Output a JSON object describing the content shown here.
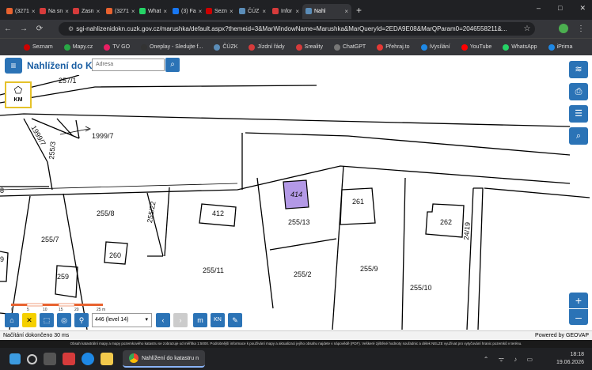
{
  "browser": {
    "tabs": [
      {
        "label": "(3271",
        "color": "#e8622f"
      },
      {
        "label": "Na sn",
        "color": "#d63b3b"
      },
      {
        "label": "Zasn",
        "color": "#d63b3b"
      },
      {
        "label": "(3271",
        "color": "#e8622f"
      },
      {
        "label": "What",
        "color": "#25d366"
      },
      {
        "label": "(3) Fa",
        "color": "#1877f2"
      },
      {
        "label": "Sezn",
        "color": "#cc0000"
      },
      {
        "label": "ČÚZ",
        "color": "#5b8db8"
      },
      {
        "label": "Infor",
        "color": "#d63b3b"
      },
      {
        "label": "Nahl",
        "color": "#5b8db8"
      }
    ],
    "new_tab": "+",
    "window_controls": [
      "–",
      "□",
      "✕"
    ],
    "url": "sgi-nahlizenidokn.cuzk.gov.cz/marushka/default.aspx?themeid=3&MarWindowName=Marushka&MarQueryId=2EDA9E08&MarQParam0=2046558211&...",
    "bookmarks": [
      {
        "label": "Seznam",
        "color": "#cc0000"
      },
      {
        "label": "Mapy.cz",
        "color": "#28a745"
      },
      {
        "label": "TV GO",
        "color": "#e91e63"
      },
      {
        "label": "Oneplay - Sledujte f...",
        "color": "#333"
      },
      {
        "label": "ČÚZK",
        "color": "#5b8db8"
      },
      {
        "label": "Jízdní řády",
        "color": "#d63b3b"
      },
      {
        "label": "Sreality",
        "color": "#d63b3b"
      },
      {
        "label": "ChatGPT",
        "color": "#777"
      },
      {
        "label": "Přehraj.to",
        "color": "#e53935"
      },
      {
        "label": "iVysílání",
        "color": "#1e88e5"
      },
      {
        "label": "YouTube",
        "color": "#ff0000"
      },
      {
        "label": "WhatsApp",
        "color": "#25d366"
      },
      {
        "label": "iPrima",
        "color": "#1e88e5"
      }
    ]
  },
  "app": {
    "title": "Nahlížení do KN",
    "search_placeholder": "Adresa",
    "km_label": "KM"
  },
  "map": {
    "parcels": [
      "257/1",
      "1999/7",
      "1999/7",
      "255/3",
      "255/7",
      "255/8",
      "255/22",
      "255/11",
      "255/13",
      "255/2",
      "255/9",
      "255/10",
      "412",
      "414",
      "261",
      "262",
      "260",
      "259",
      "24/19",
      "8",
      "9"
    ],
    "highlighted_parcel": "414",
    "scale_bar_labels": [
      "0",
      "5",
      "10",
      "15",
      "20",
      "25 m"
    ]
  },
  "toolbar": {
    "scale_value": "446 (level 14)"
  },
  "status": {
    "left": "Načítání dokončeno 30 ms",
    "right": "Powered by GEOVAP"
  },
  "disclaimer": "Obsah katastrální mapy a mapy pozemkového katastru se zobrazuje od měřítka 1:5000. Podrobnější informace k používání mapy a aktualizaci jejího obsahu najdete v nápovědě (PDF). Veškeré zjištěné hodnoty souřadnic a délek NELZE využívat pro vytyčování hranic pozemků v terénu.",
  "taskbar": {
    "active_app": "Nahlížení do katastru n",
    "time": "18:18",
    "date": "19.06.2026"
  }
}
